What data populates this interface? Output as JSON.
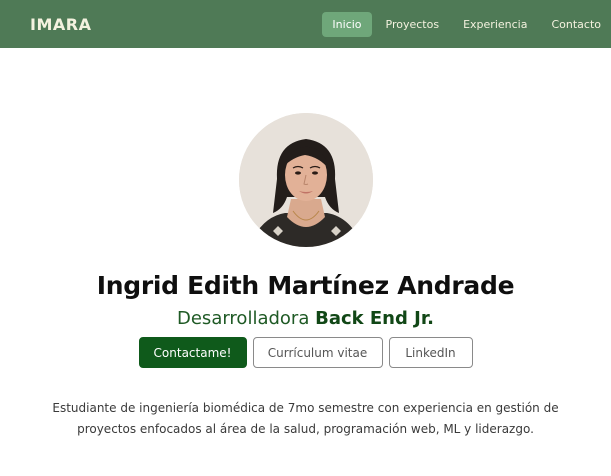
{
  "navbar": {
    "brand": "IMARA",
    "links": [
      {
        "label": "Inicio",
        "active": true
      },
      {
        "label": "Proyectos",
        "active": false
      },
      {
        "label": "Experiencia",
        "active": false
      },
      {
        "label": "Contacto",
        "active": false
      }
    ]
  },
  "profile": {
    "name": "Ingrid Edith Martínez Andrade",
    "role_prefix": "Desarrolladora",
    "role_highlight": "Back End Jr.",
    "avatar_icon": "profile-photo"
  },
  "actions": {
    "contact_label": "Contactame!",
    "cv_label": "Currículum vitae",
    "linkedin_label": "LinkedIn"
  },
  "bio": {
    "text": "Estudiante de ingeniería biomédica de 7mo semestre con experiencia en gestión de proyectos enfocados al área de la salud, programación web, ML y liderazgo."
  },
  "colors": {
    "navbar_bg": "#4f7a56",
    "nav_active_bg": "#6fa77a",
    "primary_button": "#0f5a1b",
    "role_text": "#1f5a25"
  }
}
